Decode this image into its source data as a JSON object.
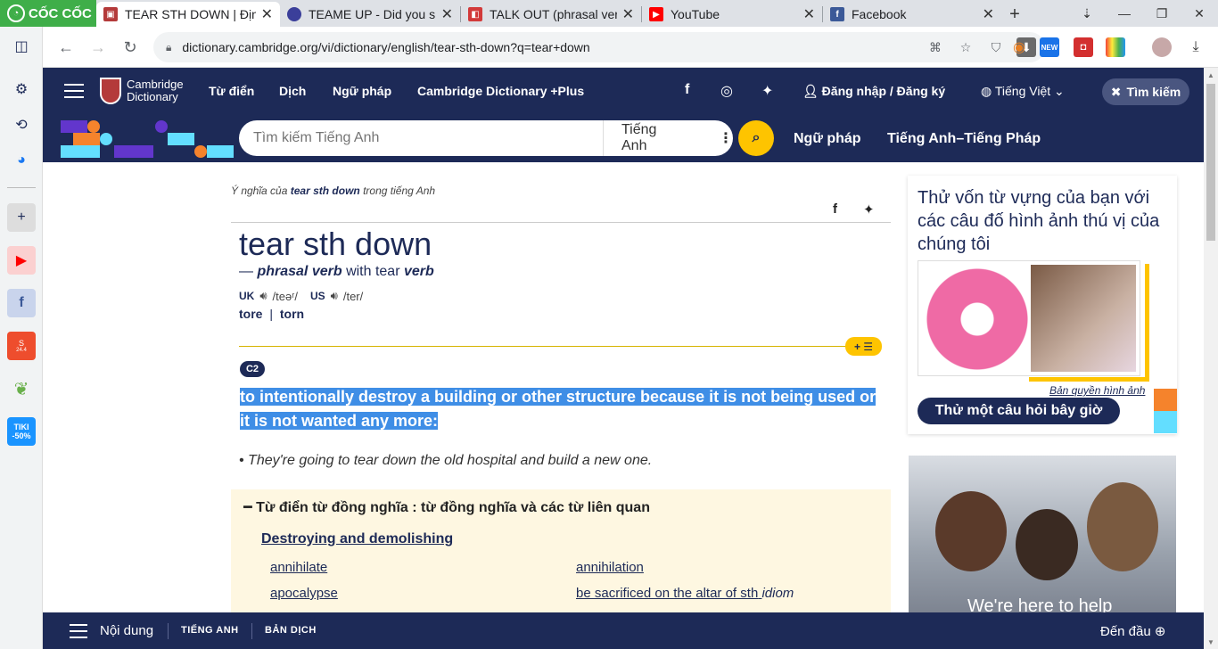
{
  "browser": {
    "brand": "CỐC CỐC",
    "tabs": [
      {
        "title": "TEAR STH DOWN | Định",
        "active": true
      },
      {
        "title": "TEAME UP - Did you sp",
        "active": false
      },
      {
        "title": "TALK OUT (phrasal verb",
        "active": false
      },
      {
        "title": "YouTube",
        "active": false
      },
      {
        "title": "Facebook",
        "active": false
      }
    ],
    "url": "dictionary.cambridge.org/vi/dictionary/english/tear-sth-down?q=tear+down",
    "ext_badge": "NEW"
  },
  "sidebar_icons": [
    "gear-icon",
    "history-icon",
    "messenger-icon",
    "add-icon",
    "youtube-icon",
    "facebook-icon",
    "shopee-icon",
    "leaf-icon",
    "tiki-icon"
  ],
  "sidebar_labels": {
    "shopee": "24.4",
    "tiki": "TIKI -50%"
  },
  "site": {
    "logo_line1": "Cambridge",
    "logo_line2": "Dictionary",
    "nav": [
      "Từ điển",
      "Dịch",
      "Ngữ pháp",
      "Cambridge Dictionary +Plus"
    ],
    "login": "Đăng nhập / Đăng ký",
    "language": "Tiếng Việt",
    "search_pill": "Tìm kiếm",
    "search_placeholder": "Tìm kiếm Tiếng Anh",
    "search_lang": "Tiếng Anh",
    "links": [
      "Ngữ pháp",
      "Tiếng Anh–Tiếng Pháp"
    ]
  },
  "entry": {
    "crumb_prefix": "Ý nghĩa của",
    "crumb_word": "tear sth down",
    "crumb_suffix": "trong tiếng Anh",
    "headword": "tear sth down",
    "pos_dash": "—",
    "pos": "phrasal verb",
    "pos_with": "with tear",
    "pos_verb": "verb",
    "uk": "UK",
    "uk_ipa": "/teəʳ/",
    "us": "US",
    "us_ipa": "/ter/",
    "form1": "tore",
    "form_sep": "|",
    "form2": "torn",
    "plus_label": "+ ☰",
    "level": "C2",
    "definition": "to intentionally destroy a building or other structure because it is not being used or it is not wanted any more:",
    "example": "They're going to tear down the old hospital and build a new one."
  },
  "thesaurus": {
    "title": "Từ điển từ đồng nghĩa : từ đồng nghĩa và các từ liên quan",
    "subtitle": "Destroying and demolishing",
    "w1": "annihilate",
    "w2": "annihilation",
    "w3": "apocalypse",
    "w4": "be sacrificed on the altar of sth",
    "w4_tag": "idiom"
  },
  "quiz": {
    "title": "Thử vốn từ vựng của bạn với các câu đố hình ảnh thú vị của chúng tôi",
    "copyright": "Bản quyền hình ảnh",
    "button": "Thử một câu hỏi bây giờ"
  },
  "ad": {
    "text": "We're here to help"
  },
  "bottom": {
    "contents": "Nội dung",
    "en": "TIẾNG ANH",
    "trans": "BẢN DỊCH",
    "top": "Đến đầu"
  },
  "colors": {
    "navy": "#1d2a57",
    "yellow": "#fec400",
    "highlight": "#3f8ee6",
    "coccoc_green": "#3fae49"
  }
}
